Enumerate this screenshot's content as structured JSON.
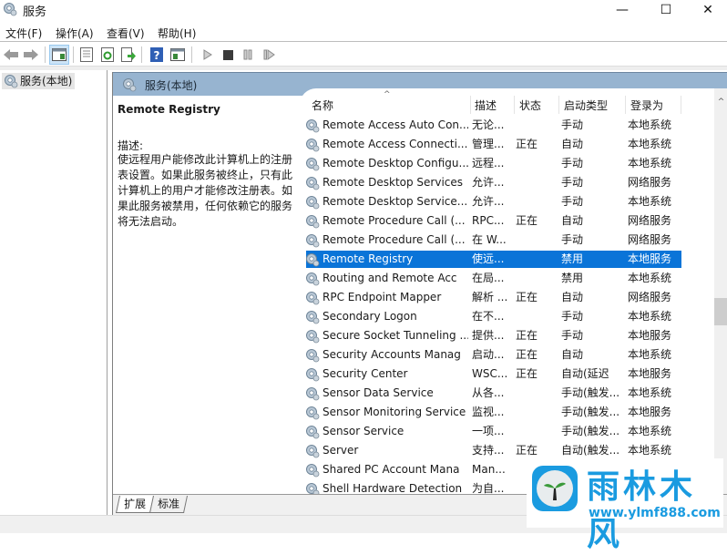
{
  "window": {
    "title": "服务",
    "controls": {
      "minimize": "—",
      "maximize": "☐",
      "close": "✕"
    }
  },
  "menu": [
    {
      "label": "文件(F)"
    },
    {
      "label": "操作(A)"
    },
    {
      "label": "查看(V)"
    },
    {
      "label": "帮助(H)"
    }
  ],
  "toolbar": {
    "buttons": [
      "back",
      "forward",
      "show-hide-console-tree",
      "properties",
      "refresh",
      "export-list",
      "help",
      "show-hide-action-pane",
      "start-service",
      "stop-service",
      "pause-service",
      "restart-service"
    ]
  },
  "tree": {
    "root_label": "服务(本地)"
  },
  "pane": {
    "header": "服务(本地)",
    "selected_service": "Remote Registry",
    "desc_label": "描述:",
    "description": "使远程用户能修改此计算机上的注册表设置。如果此服务被终止，只有此计算机上的用户才能修改注册表。如果此服务被禁用，任何依赖它的服务将无法启动。"
  },
  "table": {
    "columns": [
      "名称",
      "描述",
      "状态",
      "启动类型",
      "登录为"
    ],
    "sort_indicator": "^",
    "rows": [
      {
        "name": "Remote Access Auto Con...",
        "desc": "无论...",
        "status": "",
        "start": "手动",
        "logon": "本地系统"
      },
      {
        "name": "Remote Access Connecti...",
        "desc": "管理...",
        "status": "正在",
        "start": "自动",
        "logon": "本地系统"
      },
      {
        "name": "Remote Desktop Configu...",
        "desc": "远程...",
        "status": "",
        "start": "手动",
        "logon": "本地系统"
      },
      {
        "name": "Remote Desktop Services",
        "desc": "允许...",
        "status": "",
        "start": "手动",
        "logon": "网络服务"
      },
      {
        "name": "Remote Desktop Service...",
        "desc": "允许...",
        "status": "",
        "start": "手动",
        "logon": "本地系统"
      },
      {
        "name": "Remote Procedure Call (...",
        "desc": "RPC...",
        "status": "正在",
        "start": "自动",
        "logon": "网络服务"
      },
      {
        "name": "Remote Procedure Call (...",
        "desc": "在 W...",
        "status": "",
        "start": "手动",
        "logon": "网络服务"
      },
      {
        "name": "Remote Registry",
        "desc": "使远...",
        "status": "",
        "start": "禁用",
        "logon": "本地服务",
        "selected": true
      },
      {
        "name": "Routing and Remote Acc",
        "desc": "在局...",
        "status": "",
        "start": "禁用",
        "logon": "本地系统"
      },
      {
        "name": "RPC Endpoint Mapper",
        "desc": "解析 ...",
        "status": "正在",
        "start": "自动",
        "logon": "网络服务"
      },
      {
        "name": "Secondary Logon",
        "desc": "在不...",
        "status": "",
        "start": "手动",
        "logon": "本地系统"
      },
      {
        "name": "Secure Socket Tunneling ...",
        "desc": "提供...",
        "status": "正在",
        "start": "手动",
        "logon": "本地服务"
      },
      {
        "name": "Security Accounts Manag",
        "desc": "启动...",
        "status": "正在",
        "start": "自动",
        "logon": "本地系统"
      },
      {
        "name": "Security Center",
        "desc": "WSC...",
        "status": "正在",
        "start": "自动(延迟",
        "logon": "本地服务"
      },
      {
        "name": "Sensor Data Service",
        "desc": "从各...",
        "status": "",
        "start": "手动(触发...",
        "logon": "本地系统"
      },
      {
        "name": "Sensor Monitoring Service",
        "desc": "监视...",
        "status": "",
        "start": "手动(触发...",
        "logon": "本地服务"
      },
      {
        "name": "Sensor Service",
        "desc": "一项...",
        "status": "",
        "start": "手动(触发...",
        "logon": "本地系统"
      },
      {
        "name": "Server",
        "desc": "支持...",
        "status": "正在",
        "start": "自动(触发...",
        "logon": "本地系统"
      },
      {
        "name": "Shared PC Account Mana",
        "desc": "Man...",
        "status": "",
        "start": "",
        "logon": ""
      },
      {
        "name": "Shell Hardware Detection",
        "desc": "为自...",
        "status": "",
        "start": "",
        "logon": ""
      }
    ]
  },
  "tabs": [
    {
      "label": "扩展",
      "active": true
    },
    {
      "label": "标准",
      "active": false
    }
  ],
  "watermark": {
    "title": "雨林木风",
    "url": "www.ylmf888.com"
  },
  "colors": {
    "header_blue": "#97b4d0",
    "selection": "#0a74d8",
    "watermark": "#1a9be0"
  }
}
